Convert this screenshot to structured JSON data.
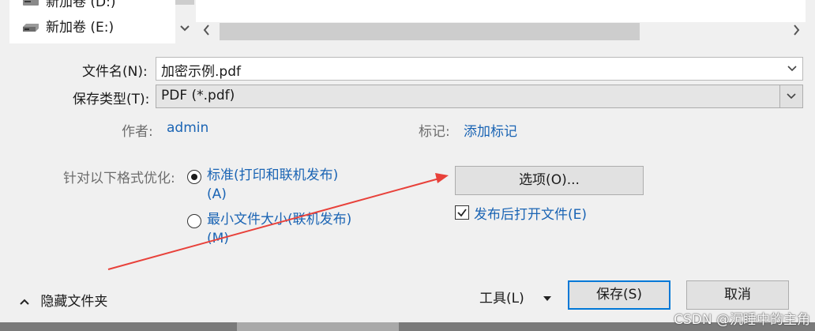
{
  "tree": {
    "items": [
      {
        "label": "新加卷 (D:)",
        "icon": "drive-icon"
      },
      {
        "label": "新加卷 (E:)",
        "icon": "drive-icon"
      }
    ]
  },
  "form": {
    "filename_label": "文件名(N):",
    "filename_value": "加密示例.pdf",
    "filetype_label": "保存类型(T):",
    "filetype_value": "PDF (*.pdf)",
    "author_label": "作者:",
    "author_value": "admin",
    "tags_label": "标记:",
    "tags_value": "添加标记"
  },
  "optimize": {
    "label": "针对以下格式优化:",
    "options": [
      {
        "label": "标准(打印和联机发布)(A)",
        "selected": true
      },
      {
        "label": "最小文件大小(联机发布)(M)",
        "selected": false
      }
    ]
  },
  "options_button": "选项(O)...",
  "open_after_publish": {
    "label": "发布后打开文件(E)",
    "checked": true
  },
  "footer": {
    "hide_folders": "隐藏文件夹",
    "tools": "工具(L)",
    "save": "保存(S)",
    "cancel": "取消"
  },
  "watermark": "CSDN @沉睡中的主角",
  "colors": {
    "accent": "#0078d7",
    "link": "#1a64b4",
    "annotation_arrow": "#e8413a"
  }
}
